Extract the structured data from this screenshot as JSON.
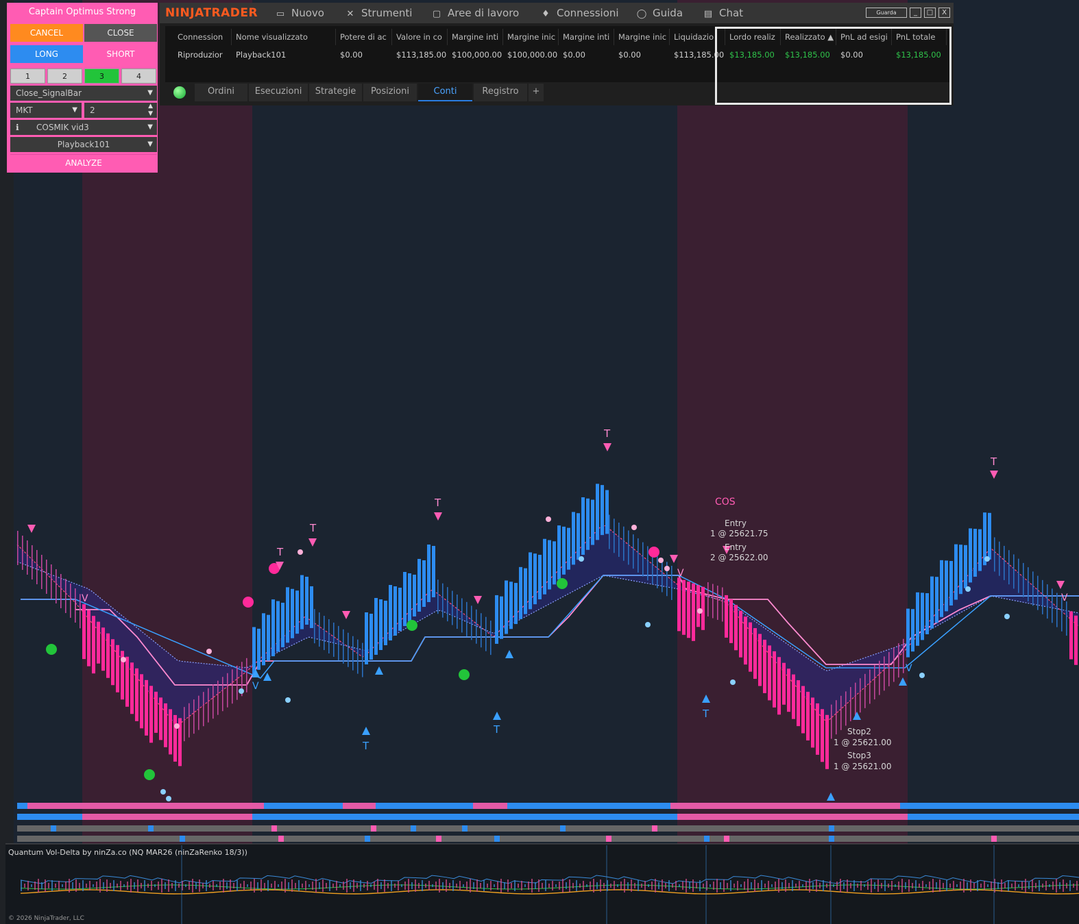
{
  "panel": {
    "title": "Captain Optimus Strong",
    "cancel": "CANCEL",
    "close": "CLOSE",
    "long": "LONG",
    "short": "SHORT",
    "numbers": [
      "1",
      "2",
      "3",
      "4"
    ],
    "selected_number": "3",
    "exit_mode": "Close_SignalBar",
    "order_type": "MKT",
    "quantity": "2",
    "strategy": "COSMIK vid3",
    "account": "Playback101",
    "analyze": "ANALYZE",
    "info_icon": "info-icon"
  },
  "app": {
    "brand": "NINJATRADER",
    "menu": [
      {
        "label": "Nuovo",
        "icon": "new-window-icon"
      },
      {
        "label": "Strumenti",
        "icon": "tools-icon"
      },
      {
        "label": "Aree di lavoro",
        "icon": "workspaces-icon"
      },
      {
        "label": "Connessioni",
        "icon": "connections-icon"
      },
      {
        "label": "Guida",
        "icon": "help-icon"
      },
      {
        "label": "Chat",
        "icon": "chat-icon"
      }
    ],
    "window_buttons": [
      "Guarda",
      "_",
      "□",
      "X"
    ]
  },
  "accounts_grid": {
    "columns": [
      "Connession",
      "Nome visualizzato",
      "Potere di ac",
      "Valore in co",
      "Margine inti",
      "Margine inic",
      "Margine inti",
      "Margine inic",
      "Liquidazio",
      "Lordo realiz",
      "Realizzato ▲",
      "PnL ad esigi",
      "PnL totale"
    ],
    "row": [
      "Riproduzior",
      "Playback101",
      "$0.00",
      "$113,185.00",
      "$100,000.00",
      "$100,000.00",
      "$0.00",
      "$0.00",
      "$113,185.00",
      "$13,185.00",
      "$13,185.00",
      "$0.00",
      "$13,185.00"
    ],
    "green_cells": [
      9,
      10,
      12
    ]
  },
  "tabs": {
    "items": [
      "Ordini",
      "Esecuzioni",
      "Strategie",
      "Posizioni",
      "Conti",
      "Registro",
      "+"
    ],
    "active": "Conti"
  },
  "annotations": {
    "cos": "COS",
    "entry1": "Entry",
    "entry1_detail": "1 @ 25621.75",
    "entry2": "Entry",
    "entry2_detail": "2 @ 25622.00",
    "stop2": "Stop2",
    "stop2_detail": "1 @ 25621.00",
    "stop3": "Stop3",
    "stop3_detail": "1 @ 25621.00",
    "t_label": "T",
    "v_label": "V"
  },
  "indicator_label": "Quantum Vol-Delta by ninZa.co (NQ MAR26 (ninZaRenko 18/3))",
  "copyright": "© 2026 NinjaTrader, LLC",
  "colors": {
    "background": "#1b2430",
    "bear_zone": "#3a1f31",
    "bull_bar": "#2d8cf0",
    "bear_bar": "#ff2a9a",
    "panel_pink": "#ff5cb3",
    "cancel_orange": "#ff8a1f",
    "long_blue": "#2d8cf0",
    "profit_green": "#2fc24a"
  }
}
